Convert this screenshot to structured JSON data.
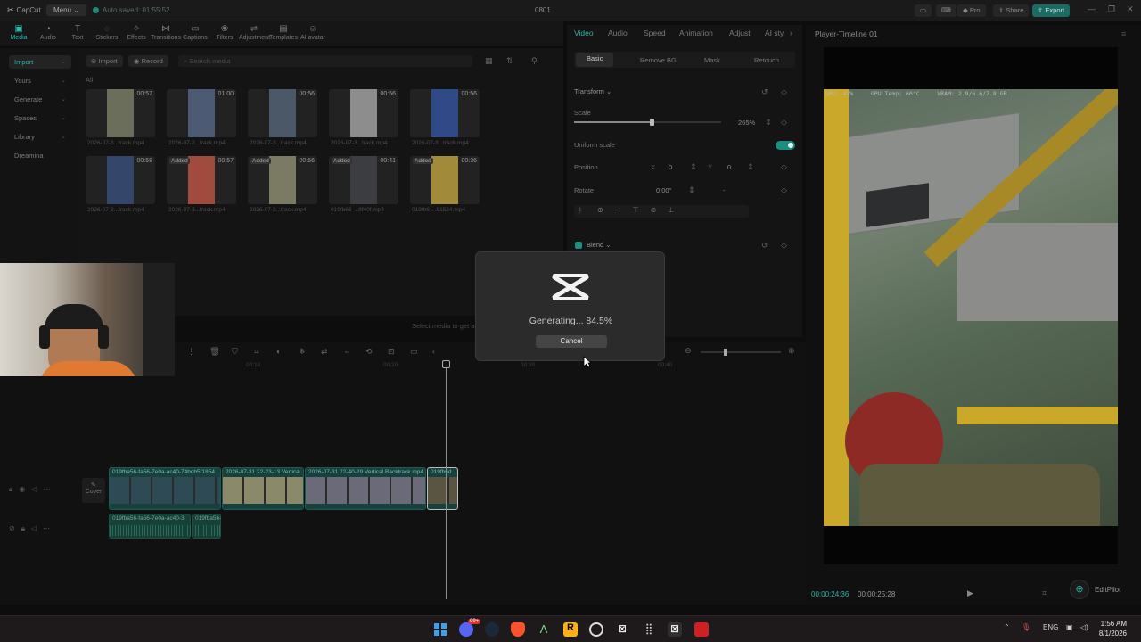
{
  "app": {
    "logo": "CapCut",
    "menu_label": "Menu",
    "autosave": "Auto saved: 01:55:52",
    "project_title": "0801",
    "pro_label": "Pro",
    "share_label": "Share",
    "export_label": "Export"
  },
  "media_tools": [
    {
      "label": "Media",
      "icon": "media-icon",
      "glyph": "▣"
    },
    {
      "label": "Audio",
      "icon": "audio-icon",
      "glyph": "◔"
    },
    {
      "label": "Text",
      "icon": "text-icon",
      "glyph": "T"
    },
    {
      "label": "Stickers",
      "icon": "stickers-icon",
      "glyph": "◌"
    },
    {
      "label": "Effects",
      "icon": "effects-icon",
      "glyph": "✧"
    },
    {
      "label": "Transitions",
      "icon": "transitions-icon",
      "glyph": "⋈"
    },
    {
      "label": "Captions",
      "icon": "captions-icon",
      "glyph": "▭"
    },
    {
      "label": "Filters",
      "icon": "filters-icon",
      "glyph": "❀"
    },
    {
      "label": "Adjustment",
      "icon": "adjustment-icon",
      "glyph": "⇌"
    },
    {
      "label": "Templates",
      "icon": "templates-icon",
      "glyph": "▤"
    },
    {
      "label": "AI avatar",
      "icon": "ai-avatar-icon",
      "glyph": "☺"
    }
  ],
  "sidebar": {
    "items": [
      {
        "label": "Import",
        "active": true
      },
      {
        "label": "Yours"
      },
      {
        "label": "Generate"
      },
      {
        "label": "Spaces"
      },
      {
        "label": "Library"
      },
      {
        "label": "Dreamina"
      }
    ]
  },
  "media": {
    "import_label": "Import",
    "record_label": "Record",
    "search_placeholder": "Search media",
    "all_label": "All",
    "items": [
      {
        "name": "2026-07-3...track.mp4",
        "duration": "00:57",
        "added": "",
        "color": "#6b6e5a"
      },
      {
        "name": "2026-07-3...track.mp4",
        "duration": "01:00",
        "added": "",
        "color": "#4d5a74"
      },
      {
        "name": "2026-07-3...track.mp4",
        "duration": "00:56",
        "added": "",
        "color": "#4b5868"
      },
      {
        "name": "2026-07-3...track.mp4",
        "duration": "00:56",
        "added": "",
        "color": "#8d8d8d"
      },
      {
        "name": "2026-07-3...track.mp4",
        "duration": "00:56",
        "added": "",
        "color": "#2f4a86"
      },
      {
        "name": "2026-07-3...track.mp4",
        "duration": "00:58",
        "added": "",
        "color": "#34466a"
      },
      {
        "name": "2026-07-3...track.mp4",
        "duration": "00:57",
        "added": "Added",
        "color": "#a14a3e"
      },
      {
        "name": "2026-07-3...track.mp4",
        "duration": "00:56",
        "added": "Added",
        "color": "#7b7a62"
      },
      {
        "name": "019fb66-...8f40f.mp4",
        "duration": "00:41",
        "added": "Added",
        "color": "#3b3d40"
      },
      {
        "name": "019fb6-...91524.mp4",
        "duration": "00:36",
        "added": "Added",
        "color": "#a18a3a"
      }
    ],
    "select_hint": "Select media to get a"
  },
  "props": {
    "tabs": [
      "Video",
      "Audio",
      "Speed",
      "Animation",
      "Adjust",
      "AI sty"
    ],
    "subtabs": [
      "Basic",
      "Remove BG",
      "Mask",
      "Retouch"
    ],
    "transform_label": "Transform",
    "scale_label": "Scale",
    "scale_value": "265%",
    "scale_fraction": 0.53,
    "uniform_label": "Uniform scale",
    "position_label": "Position",
    "pos_x_label": "X",
    "pos_x": "0",
    "pos_y_label": "Y",
    "pos_y": "0",
    "rotate_label": "Rotate",
    "rotate_value": "0.00°",
    "rotate_extra": "-",
    "blend_label": "Blend"
  },
  "player": {
    "title": "Player-Timeline 01",
    "hud_gpu": "GPU: 47%",
    "hud_temp": "GPU Temp: 60°C",
    "hud_vram": "VRAM: 2.9/6.6/7.8 GB",
    "time_current": "00:00:24:36",
    "time_total": "00:00:25:28"
  },
  "timeline": {
    "ruler": [
      "00:10",
      "00:20",
      "00:30",
      "00:40"
    ],
    "cover_label": "Cover",
    "clips": [
      {
        "label": "019fba56-fa56-7e0a-ac40-74bdb5f1854",
        "color": "#2e4a55"
      },
      {
        "label": "2026-07-31 22-23-13 Vertica",
        "color": "#8a8a6a"
      },
      {
        "label": "2026-07-31 22-40-29 Vertical Backtrack.mp4",
        "color": "#6a6a78"
      },
      {
        "label": "019fb6d",
        "color": "#5a5440"
      }
    ],
    "audio_clips": [
      {
        "label": "019fba56-fa56-7e0a-ac40-3"
      },
      {
        "label": "019fba56-"
      }
    ]
  },
  "modal": {
    "text": "Generating... 84.5%",
    "progress": 0.845,
    "cancel_label": "Cancel"
  },
  "editpilot": {
    "label": "EditPilot"
  },
  "taskbar": {
    "lang": "ENG",
    "time": "1:56 AM",
    "date": "8/1/2026",
    "badge": "99+"
  }
}
